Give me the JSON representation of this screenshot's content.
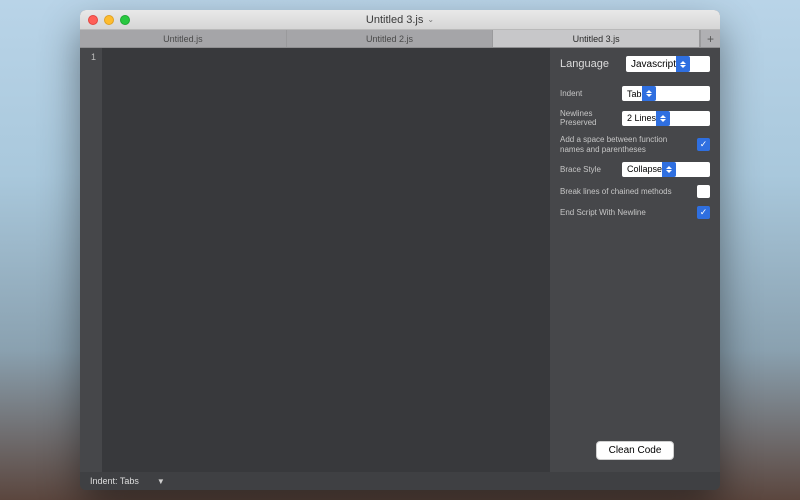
{
  "window": {
    "title": "Untitled 3.js"
  },
  "tabs": {
    "items": [
      {
        "label": "Untitled.js"
      },
      {
        "label": "Untitled 2.js"
      },
      {
        "label": "Untitled 3.js"
      }
    ],
    "add_glyph": "+"
  },
  "editor": {
    "first_line_number": "1"
  },
  "sidebar": {
    "language_label": "Language",
    "language_value": "Javascript",
    "indent_label": "Indent",
    "indent_value": "Tab",
    "newlines_label": "Newlines Preserved",
    "newlines_value": "2 Lines",
    "space_label": "Add a space between function names and parentheses",
    "brace_label": "Brace Style",
    "brace_value": "Collapse",
    "chain_label": "Break lines of chained methods",
    "endnl_label": "End Script With Newline",
    "clean_label": "Clean Code",
    "checks": {
      "space_fn": true,
      "chain": false,
      "endnl": true
    }
  },
  "statusbar": {
    "indent_label": "Indent: Tabs"
  }
}
